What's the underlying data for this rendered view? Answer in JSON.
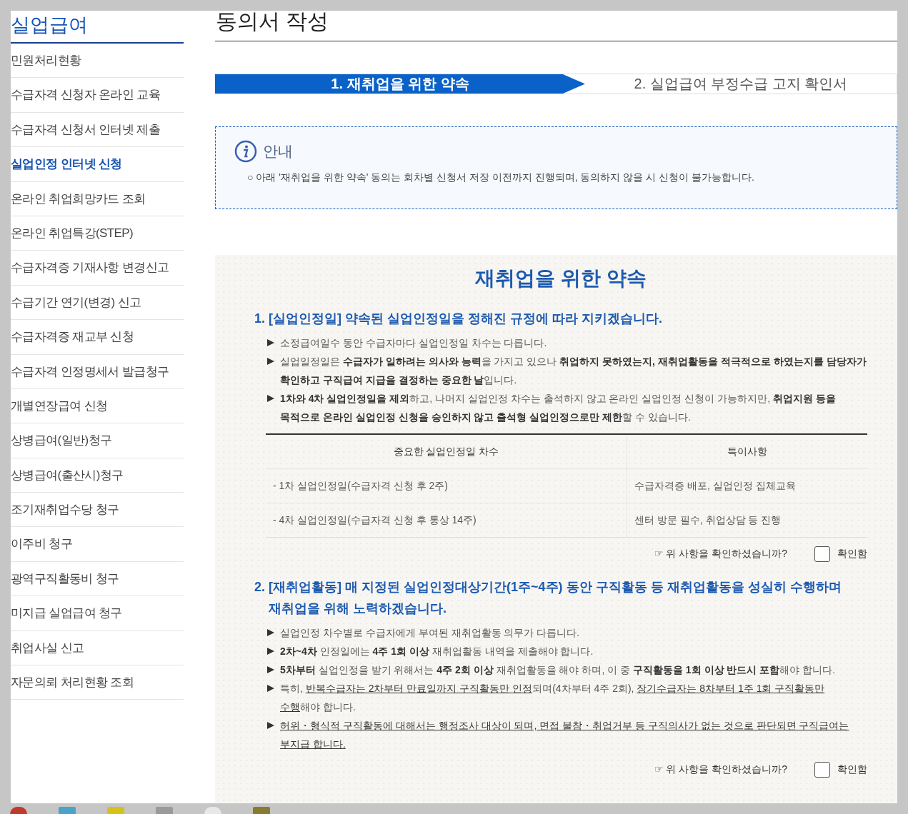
{
  "sidebar": {
    "title": "실업급여",
    "items": [
      {
        "label": "민원처리현황",
        "selected": false
      },
      {
        "label": "수급자격 신청자 온라인 교육",
        "selected": false
      },
      {
        "label": "수급자격 신청서 인터넷 제출",
        "selected": false
      },
      {
        "label": "실업인정 인터넷 신청",
        "selected": true
      },
      {
        "label": "온라인 취업희망카드 조회",
        "selected": false
      },
      {
        "label": "온라인 취업특강(STEP)",
        "selected": false
      },
      {
        "label": "수급자격증 기재사항 변경신고",
        "selected": false
      },
      {
        "label": "수급기간 연기(변경) 신고",
        "selected": false
      },
      {
        "label": "수급자격증 재교부 신청",
        "selected": false
      },
      {
        "label": "수급자격 인정명세서 발급청구",
        "selected": false
      },
      {
        "label": "개별연장급여 신청",
        "selected": false
      },
      {
        "label": "상병급여(일반)청구",
        "selected": false
      },
      {
        "label": "상병급여(출산시)청구",
        "selected": false
      },
      {
        "label": "조기재취업수당 청구",
        "selected": false
      },
      {
        "label": "이주비 청구",
        "selected": false
      },
      {
        "label": "광역구직활동비 청구",
        "selected": false
      },
      {
        "label": "미지급 실업급여 청구",
        "selected": false
      },
      {
        "label": "취업사실 신고",
        "selected": false
      },
      {
        "label": "자문의뢰 처리현황 조회",
        "selected": false
      }
    ]
  },
  "page_title": "동의서 작성",
  "steps": [
    {
      "label": "1. 재취업을 위한 약속",
      "selected": true
    },
    {
      "label": "2. 실업급여 부정수급 고지 확인서",
      "selected": false
    }
  ],
  "notice": {
    "title": "안내",
    "text": "○ 아래 '재취업을 위한 약속' 동의는 회차별 신청서 저장 이전까지 진행되며, 동의하지 않을 시 신청이 불가능합니다."
  },
  "promise": {
    "title": "재취업을 위한 약속",
    "sections": [
      {
        "heading": "1. [실업인정일] 약속된 실업인정일을 정해진 규정에 따라 지키겠습니다.",
        "bullets": [
          [
            {
              "text": "소정급여일수 동안 수급자마다 실업인정일 차수는 다릅니다.",
              "kind": "plain"
            }
          ],
          [
            {
              "text": "실업일정일은 ",
              "kind": "plain"
            },
            {
              "text": "수급자가 일하려는 의사와 능력",
              "kind": "bold"
            },
            {
              "text": "을 가지고 있으나 ",
              "kind": "plain"
            },
            {
              "text": "취업하지 못하였는지, 재취업활동을 적극적으로 하였는지를 담당자가 확인하고 구직급여 지급을 결정하는 중요한 날",
              "kind": "bold"
            },
            {
              "text": "입니다.",
              "kind": "plain"
            }
          ],
          [
            {
              "text": "1차와 4차 실업인정일을 제외",
              "kind": "bold"
            },
            {
              "text": "하고, 나머지 실업인정 차수는 출석하지 않고 온라인 실업인정 신청이 가능하지만, ",
              "kind": "plain"
            },
            {
              "text": "취업지원 등을 목적으로 온라인 실업인정 신청을 승인하지 않고 출석형 실업인정으로만 제한",
              "kind": "bold"
            },
            {
              "text": "할 수 있습니다.",
              "kind": "plain"
            }
          ]
        ],
        "table": {
          "columns": [
            "중요한 실업인정일 차수",
            "특이사항"
          ],
          "rows": [
            [
              "- 1차 실업인정일(수급자격 신청 후 2주)",
              "수급자격증 배포, 실업인정 집체교육"
            ],
            [
              "- 4차 실업인정일(수급자격 신청 후 통상 14주)",
              "센터 방문 필수, 취업상담 등 진행"
            ]
          ]
        },
        "confirm": {
          "question": "☞ 위 사항을 확인하셨습니까?",
          "label": "확인함",
          "checked": false
        }
      },
      {
        "heading": "2. [재취업활동] 매 지정된 실업인정대상기간(1주~4주) 동안 구직활동 등 재취업활동을 성실히 수행하며 재취업을 위해 노력하겠습니다.",
        "bullets": [
          [
            {
              "text": "실업인정 차수별로 수급자에게 부여된 재취업활동 의무가 다릅니다.",
              "kind": "plain"
            }
          ],
          [
            {
              "text": "2차~4차",
              "kind": "bold"
            },
            {
              "text": " 인정일에는 ",
              "kind": "plain"
            },
            {
              "text": "4주 1회 이상",
              "kind": "bold"
            },
            {
              "text": " 재취업활동 내역을 제출해야 합니다.",
              "kind": "plain"
            }
          ],
          [
            {
              "text": "5차부터",
              "kind": "bold"
            },
            {
              "text": " 실업인정을 받기 위해서는 ",
              "kind": "plain"
            },
            {
              "text": "4주 2회 이상",
              "kind": "bold"
            },
            {
              "text": " 재취업활동을 해야 하며, 이 중 ",
              "kind": "plain"
            },
            {
              "text": "구직활동을 1회 이상 반드시 포함",
              "kind": "bold"
            },
            {
              "text": "해야 합니다.",
              "kind": "plain"
            }
          ],
          [
            {
              "text": "특히, ",
              "kind": "plain"
            },
            {
              "text": "반복수급자는 2차부터 만료일까지 구직활동만 인정",
              "kind": "underline"
            },
            {
              "text": "되며(4차부터 4주 2회), ",
              "kind": "plain"
            },
            {
              "text": "장기수급자는 8차부터 1주 1회 구직활동만 수행",
              "kind": "underline"
            },
            {
              "text": "해야 합니다.",
              "kind": "plain"
            }
          ],
          [
            {
              "text": "허위・형식적 구직활동에 대해서는 행정조사 대상이 되며, 면접 불참・취업거부 등 구직의사가 없는 것으로 판단되면 구직급여는 부지급 합니다.",
              "kind": "underline"
            }
          ]
        ],
        "confirm": {
          "question": "☞ 위 사항을 확인하셨습니까?",
          "label": "확인함",
          "checked": false
        }
      }
    ]
  }
}
